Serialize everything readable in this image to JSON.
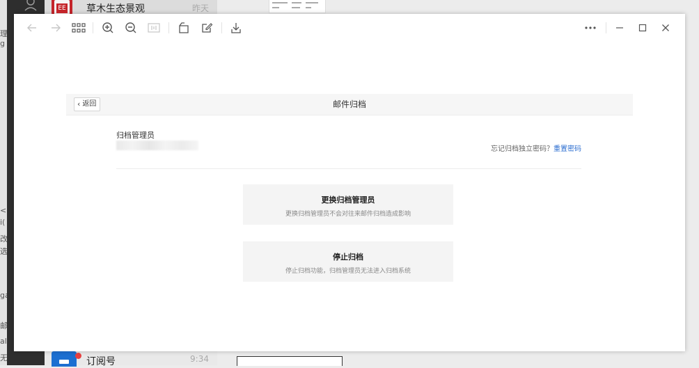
{
  "background": {
    "top_item": {
      "name": "草木生态景观",
      "time": "昨天",
      "icon_text": "EE"
    },
    "bottom_item": {
      "name": "订阅号",
      "time": "9:34"
    },
    "left_clip": [
      "理",
      "g",
      "<",
      "i(",
      "改",
      "选",
      "ga",
      "邮",
      "all",
      "无"
    ]
  },
  "toolbar": {
    "back": "arrow-left-icon",
    "forward": "arrow-right-icon",
    "grid": "grid-icon",
    "zoom_in": "zoom-in-icon",
    "zoom_out": "zoom-out-icon",
    "fit": "fit-width-icon",
    "rotate": "rotate-icon",
    "edit": "edit-icon",
    "download": "download-icon",
    "more": "more-icon",
    "minimize": "minimize-icon",
    "maximize": "maximize-icon",
    "close": "close-icon"
  },
  "archive": {
    "back_label": "返回",
    "title": "邮件归档",
    "admin_label": "归档管理员",
    "forgot_text": "忘记归档独立密码？",
    "reset_link": "重置密码",
    "cards": [
      {
        "title": "更换归档管理员",
        "desc": "更换归档管理员不会对往来邮件归档造成影响"
      },
      {
        "title": "停止归档",
        "desc": "停止归档功能，归档管理员无法进入归档系统"
      }
    ]
  },
  "colors": {
    "link": "#2e6fd0",
    "card_bg": "#f4f4f4",
    "header_bg": "#f6f6f6"
  }
}
